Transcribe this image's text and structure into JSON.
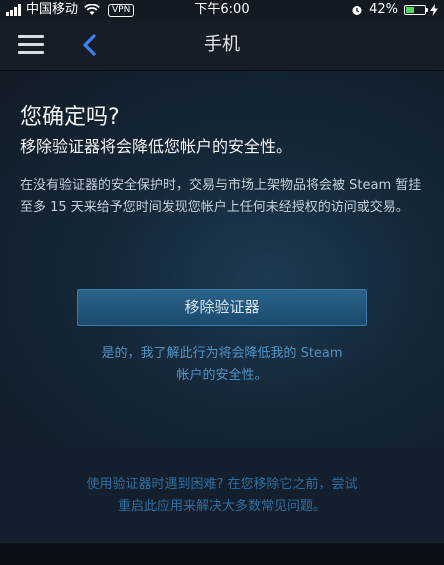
{
  "statusbar": {
    "carrier": "中国移动",
    "vpn": "VPN",
    "time": "下午6:00",
    "battery": "42%",
    "battery_level": 0.42,
    "battery_color": "#4cd964"
  },
  "navbar": {
    "menu_icon": "hamburger-menu-icon",
    "back_icon": "chevron-left-icon",
    "title": "手机",
    "back_color": "#3b82f6"
  },
  "main": {
    "confirm_title": "您确定吗?",
    "subtitle": "移除验证器将会降低您帐户的安全性。",
    "description": "在没有验证器的安全保护时，交易与市场上架物品将会被 Steam 暂挂至多 15 天来给予您时间发现您帐户上任何未经授权的访问或交易。",
    "remove_button": "移除验证器",
    "ack_line1": "是的，我了解此行为将会降低我的 Steam",
    "ack_line2": "帐户的安全性。"
  },
  "help": {
    "line1": "使用验证器时遇到困难? 在您移除它之前，尝试",
    "line2": "重启此应用来解决大多数常见问题。"
  }
}
